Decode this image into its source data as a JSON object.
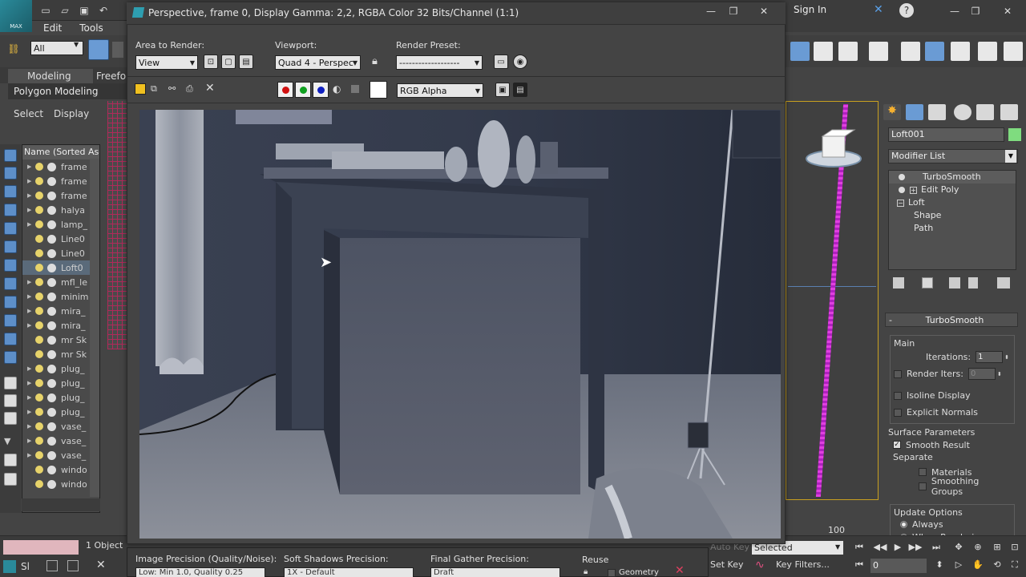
{
  "app": {
    "logo_text": "MAX",
    "signin": "Sign In",
    "menu": [
      "Edit",
      "Tools"
    ],
    "selection_filter": "All",
    "ribbon_tabs": [
      "Modeling",
      "Freefor"
    ],
    "ribbon_sub": "Polygon Modeling",
    "explorer_tabs": [
      "Select",
      "Display"
    ]
  },
  "scene_explorer": {
    "header": "Name (Sorted Ascer",
    "items": [
      {
        "name": "frame",
        "expand": true,
        "type": "bulb",
        "selected": false
      },
      {
        "name": "frame",
        "expand": true,
        "type": "bulb",
        "selected": false
      },
      {
        "name": "frame",
        "expand": true,
        "type": "bulb",
        "selected": false
      },
      {
        "name": "halya",
        "expand": true,
        "type": "bulb",
        "selected": false
      },
      {
        "name": "lamp_",
        "expand": true,
        "type": "bulb",
        "selected": false
      },
      {
        "name": "Line0",
        "expand": false,
        "type": "bulb",
        "selected": false
      },
      {
        "name": "Line0",
        "expand": false,
        "type": "bulb",
        "selected": false
      },
      {
        "name": "Loft0",
        "expand": false,
        "type": "obj",
        "selected": true
      },
      {
        "name": "mfl_le",
        "expand": true,
        "type": "bulb",
        "selected": false
      },
      {
        "name": "minim",
        "expand": true,
        "type": "bulb",
        "selected": false
      },
      {
        "name": "mira_",
        "expand": true,
        "type": "bulb",
        "selected": false
      },
      {
        "name": "mira_",
        "expand": true,
        "type": "bulb",
        "selected": false
      },
      {
        "name": "mr Sk",
        "expand": false,
        "type": "bulb",
        "selected": false
      },
      {
        "name": "mr Sk",
        "expand": false,
        "type": "bulb",
        "selected": false
      },
      {
        "name": "plug_",
        "expand": true,
        "type": "bulb",
        "selected": false
      },
      {
        "name": "plug_",
        "expand": true,
        "type": "bulb",
        "selected": false
      },
      {
        "name": "plug_",
        "expand": true,
        "type": "bulb",
        "selected": false
      },
      {
        "name": "plug_",
        "expand": true,
        "type": "bulb",
        "selected": false
      },
      {
        "name": "vase_",
        "expand": true,
        "type": "bulb",
        "selected": false
      },
      {
        "name": "vase_",
        "expand": true,
        "type": "bulb",
        "selected": false
      },
      {
        "name": "vase_",
        "expand": true,
        "type": "bulb",
        "selected": false
      },
      {
        "name": "windo",
        "expand": false,
        "type": "obj",
        "selected": false
      },
      {
        "name": "windo",
        "expand": false,
        "type": "obj",
        "selected": false
      }
    ]
  },
  "render_window": {
    "title": "Perspective, frame 0, Display Gamma: 2,2, RGBA Color 32 Bits/Channel (1:1)",
    "area_to_render_label": "Area to Render:",
    "area_to_render_value": "View",
    "viewport_label": "Viewport:",
    "viewport_value": "Quad 4 - Perspec",
    "render_preset_label": "Render Preset:",
    "render_preset_value": "-------------------",
    "channel_value": "RGB Alpha",
    "bottom": {
      "image_precision_label": "Image Precision (Quality/Noise):",
      "image_precision_value": "Low: Min 1.0, Quality 0.25",
      "soft_shadows_label": "Soft Shadows Precision:",
      "soft_shadows_value": "1X - Default",
      "final_gather_label": "Final Gather Precision:",
      "final_gather_value": "Draft",
      "reuse_label": "Reuse",
      "geometry_label": "Geometry"
    }
  },
  "command_panel": {
    "object_name": "Loft001",
    "object_color": "#7fdc7f",
    "modifier_list": "Modifier List",
    "stack": [
      "TurboSmooth",
      "Edit Poly",
      "Loft",
      "Shape",
      "Path"
    ],
    "rollout_title": "TurboSmooth",
    "main_group": "Main",
    "iterations_label": "Iterations:",
    "iterations_value": "1",
    "render_iters_label": "Render Iters:",
    "render_iters_value": "0",
    "isoline_label": "Isoline Display",
    "explicit_normals_label": "Explicit Normals",
    "surface_params_label": "Surface Parameters",
    "smooth_result_label": "Smooth Result",
    "separate_label": "Separate",
    "materials_label": "Materials",
    "smoothing_groups_label": "Smoothing Groups",
    "update_options_label": "Update Options",
    "always_label": "Always",
    "when_rendering_label": "When Rendering"
  },
  "status": {
    "object_count": "1 Object",
    "auto_key": "Auto Key",
    "set_key": "Set Key",
    "selected": "Selected",
    "key_filters": "Key Filters...",
    "frame": "0",
    "timeline_end": "100"
  }
}
